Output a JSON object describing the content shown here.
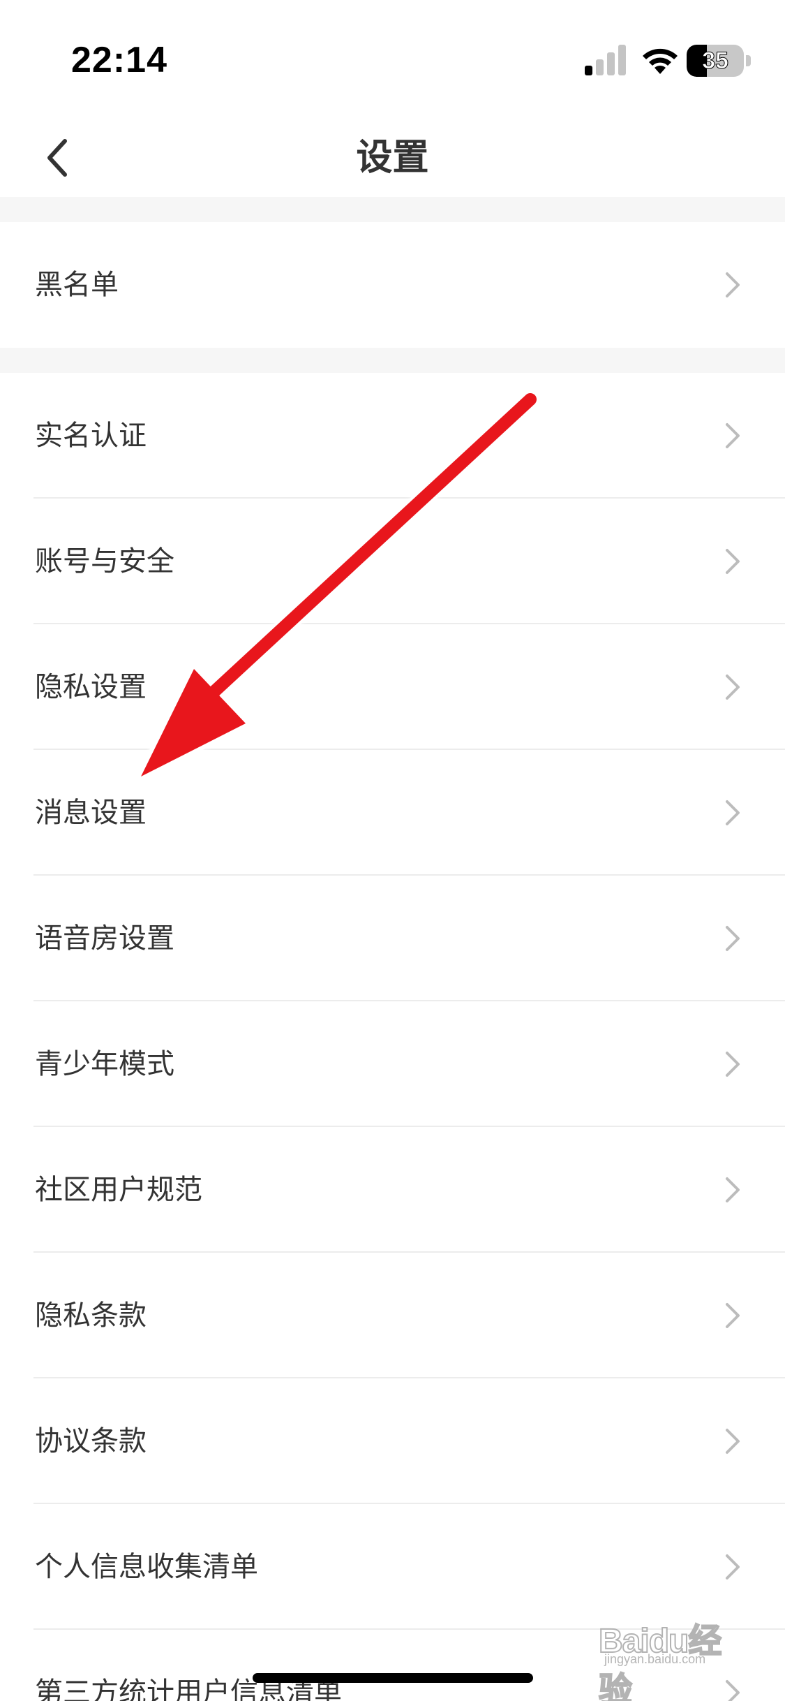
{
  "status_bar": {
    "time": "22:14",
    "battery_level": "35",
    "battery_fraction": 0.35
  },
  "nav": {
    "title": "设置",
    "back_icon": "chevron-left-icon"
  },
  "settings": {
    "group1": [
      {
        "label": "黑名单"
      }
    ],
    "group2": [
      {
        "label": "实名认证"
      },
      {
        "label": "账号与安全"
      },
      {
        "label": "隐私设置"
      },
      {
        "label": "消息设置"
      },
      {
        "label": "语音房设置"
      },
      {
        "label": "青少年模式"
      },
      {
        "label": "社区用户规范"
      },
      {
        "label": "隐私条款"
      },
      {
        "label": "协议条款"
      },
      {
        "label": "个人信息收集清单"
      },
      {
        "label": "第三方统计用户信息清单"
      }
    ]
  },
  "annotation": {
    "arrow_color": "#e8141b",
    "points_to": "消息设置"
  },
  "watermark": {
    "text": "Baidu经验",
    "sub": "jingyan.baidu.com"
  },
  "colors": {
    "background": "#ffffff",
    "group_gap": "#f6f6f6",
    "text": "#333333",
    "chevron": "#bcbcbc"
  }
}
